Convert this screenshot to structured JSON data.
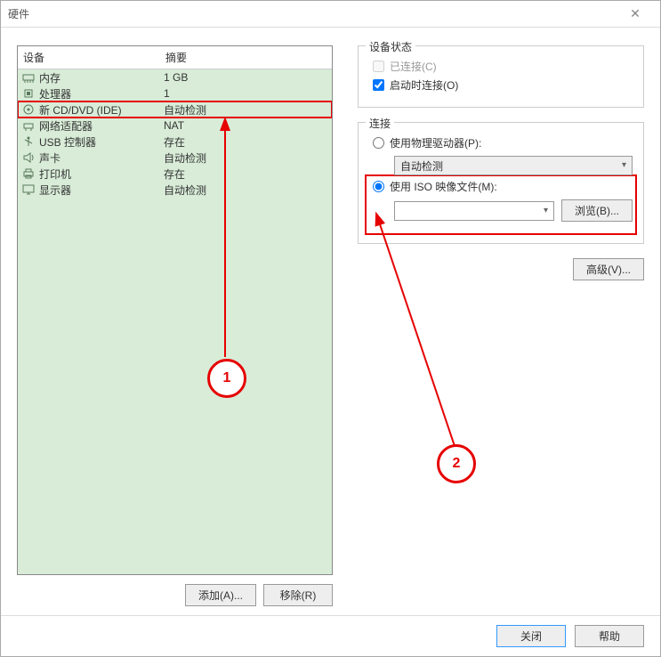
{
  "window": {
    "title": "硬件"
  },
  "table": {
    "header_device": "设备",
    "header_summary": "摘要",
    "rows": [
      {
        "icon": "memory",
        "name": "内存",
        "summary": "1 GB"
      },
      {
        "icon": "cpu",
        "name": "处理器",
        "summary": "1"
      },
      {
        "icon": "disc",
        "name": "新 CD/DVD (IDE)",
        "summary": "自动检测",
        "selected": true
      },
      {
        "icon": "net",
        "name": "网络适配器",
        "summary": "NAT"
      },
      {
        "icon": "usb",
        "name": "USB 控制器",
        "summary": "存在"
      },
      {
        "icon": "sound",
        "name": "声卡",
        "summary": "自动检测"
      },
      {
        "icon": "printer",
        "name": "打印机",
        "summary": "存在"
      },
      {
        "icon": "display",
        "name": "显示器",
        "summary": "自动检测"
      }
    ]
  },
  "buttons": {
    "add": "添加(A)...",
    "remove": "移除(R)",
    "browse": "浏览(B)...",
    "advanced": "高级(V)...",
    "close": "关闭",
    "help": "帮助"
  },
  "status_group": {
    "legend": "设备状态",
    "connected": "已连接(C)",
    "connect_on_power": "启动时连接(O)"
  },
  "connect_group": {
    "legend": "连接",
    "use_physical": "使用物理驱动器(P):",
    "auto_detect": "自动检测",
    "use_iso": "使用 ISO 映像文件(M):",
    "iso_path": ""
  },
  "annotations": {
    "one": "1",
    "two": "2"
  }
}
